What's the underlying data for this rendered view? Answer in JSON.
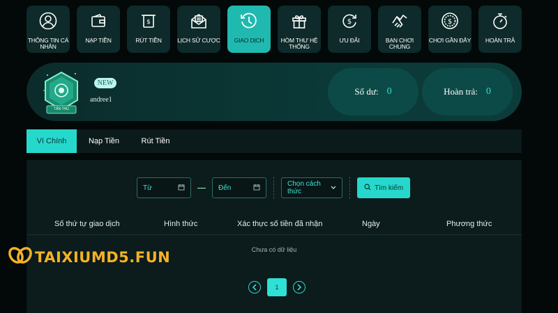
{
  "nav": [
    {
      "label": "THÔNG TIN CÁ NHÂN",
      "icon": "user-icon"
    },
    {
      "label": "NẠP TIỀN",
      "icon": "wallet-icon"
    },
    {
      "label": "RÚT TIỀN",
      "icon": "atm-withdraw-icon"
    },
    {
      "label": "LỊCH SỬ CƯỢC",
      "icon": "mail-history-icon"
    },
    {
      "label": "GIAO DỊCH",
      "icon": "clock-history-icon",
      "active": true
    },
    {
      "label": "HÒM THƯ HỆ THỐNG",
      "icon": "gift-box-icon"
    },
    {
      "label": "ƯU ĐÃI",
      "icon": "dollar-refresh-icon"
    },
    {
      "label": "BẠN CHƠI CHUNG",
      "icon": "handshake-icon"
    },
    {
      "label": "CHƠI GẦN ĐÂY",
      "icon": "dollar-coin-icon"
    },
    {
      "label": "HOÀN TRẢ",
      "icon": "stopwatch-icon"
    }
  ],
  "profile": {
    "badge_text": "TÂN THỦ",
    "new_tag": "NEW",
    "username": "andree1",
    "balance_label": "Số dư:",
    "balance_value": "0",
    "refund_label": "Hoàn trả:",
    "refund_value": "0"
  },
  "tabs": [
    {
      "label": "Ví Chính",
      "active": true
    },
    {
      "label": "Nạp Tiền"
    },
    {
      "label": "Rút Tiền"
    }
  ],
  "filters": {
    "from": "Từ",
    "to": "Đến",
    "method_select": "Chọn cách thức",
    "search_button": "Tìm kiếm"
  },
  "table": {
    "headers": [
      "Số thứ tự giao dịch",
      "Hình thức",
      "Xác thực số tiền đã nhận",
      "Ngày",
      "Phương thức"
    ],
    "empty_text": "Chưa có dữ liệu"
  },
  "pagination": {
    "current_page": "1"
  },
  "watermark": {
    "text": "TAIXIUMD5.FUN"
  },
  "colors": {
    "accent": "#26d8cc",
    "panel": "#0c1b1b",
    "background": "#030808",
    "watermark": "#f2b227"
  }
}
